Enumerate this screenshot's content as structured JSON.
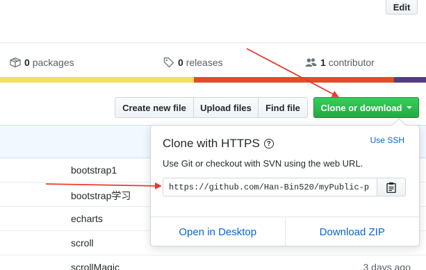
{
  "header": {
    "edit_label": "Edit"
  },
  "stats": {
    "packages_count": "0",
    "packages_label": "packages",
    "releases_count": "0",
    "releases_label": "releases",
    "contributors_count": "1",
    "contributors_label": "contributor"
  },
  "language_bar": [
    {
      "color": "#f1e05a",
      "fraction": 0.455
    },
    {
      "color": "#e34c26",
      "fraction": 0.47
    },
    {
      "color": "#563d7c",
      "fraction": 0.075
    }
  ],
  "toolbar": {
    "create_label": "Create new file",
    "upload_label": "Upload files",
    "find_label": "Find file",
    "clone_label": "Clone or download"
  },
  "files": [
    {
      "name": "bootstrap1",
      "age": ""
    },
    {
      "name": "bootstrap学习",
      "age": ""
    },
    {
      "name": "echarts",
      "age": ""
    },
    {
      "name": "scroll",
      "age": ""
    },
    {
      "name": "scrollMagic",
      "age": "3 days ago"
    }
  ],
  "clone_popover": {
    "title": "Clone with HTTPS",
    "use_ssh_label": "Use SSH",
    "description": "Use Git or checkout with SVN using the web URL.",
    "url": "https://github.com/Han-Bin520/myPublic-p",
    "open_desktop_label": "Open in Desktop",
    "download_zip_label": "Download ZIP"
  },
  "colors": {
    "accent_link": "#0366d6",
    "clone_green": "#28a745",
    "annotation_red": "#e8392f"
  },
  "icons": [
    "package-icon",
    "tag-icon",
    "people-icon",
    "help-icon",
    "clipboard-icon",
    "caret-down-icon"
  ]
}
